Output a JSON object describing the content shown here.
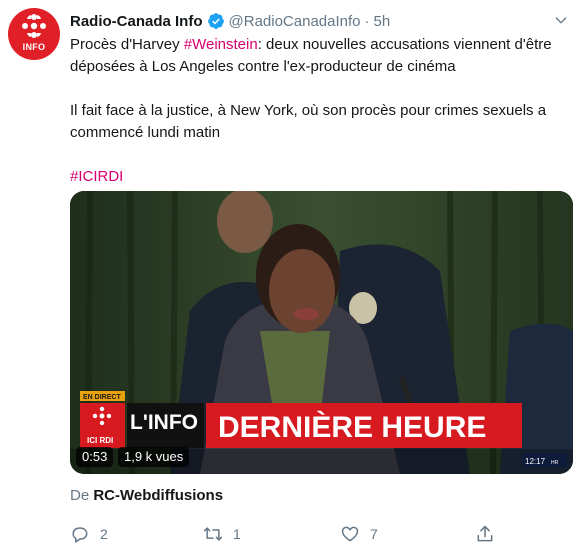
{
  "tweet": {
    "author": {
      "display_name": "Radio-Canada Info",
      "handle": "@RadioCanadaInfo",
      "time": "5h",
      "avatar_text": "INFO",
      "verified": true
    },
    "text": {
      "line1_prefix": "Procès d'Harvey ",
      "line1_hashtag": "#Weinstein",
      "line1_suffix": ": deux nouvelles accusations viennent d'être déposées à Los Angeles contre l'ex-producteur de cinéma",
      "paragraph2": "Il fait face à la justice, à New York, où son procès pour crimes sexuels a commencé lundi matin",
      "hashtag_line": "#ICIRDI"
    },
    "video": {
      "live_badge": "EN DIRECT",
      "channel_label": "ICI RDI",
      "show_label": "L'INFO",
      "breaking_banner": "DERNIÈRE HEURE",
      "clock": "12:17",
      "clock_suffix": "HR",
      "duration": "0:53",
      "views": "1,9 k vues"
    },
    "source": {
      "prefix": "De ",
      "name": "RC-Webdiffusions"
    },
    "actions": {
      "reply_count": "2",
      "retweet_count": "1",
      "like_count": "7",
      "share_count": ""
    }
  },
  "colors": {
    "brand_red": "#e11f26",
    "hashtag": "#d6006f",
    "verified": "#1da1f2",
    "muted": "#657786",
    "banner_red": "#d71920"
  },
  "icons": [
    "caret-down-icon",
    "verified-badge-icon",
    "reply-icon",
    "retweet-icon",
    "like-icon",
    "share-icon",
    "radio-canada-gem-icon"
  ]
}
